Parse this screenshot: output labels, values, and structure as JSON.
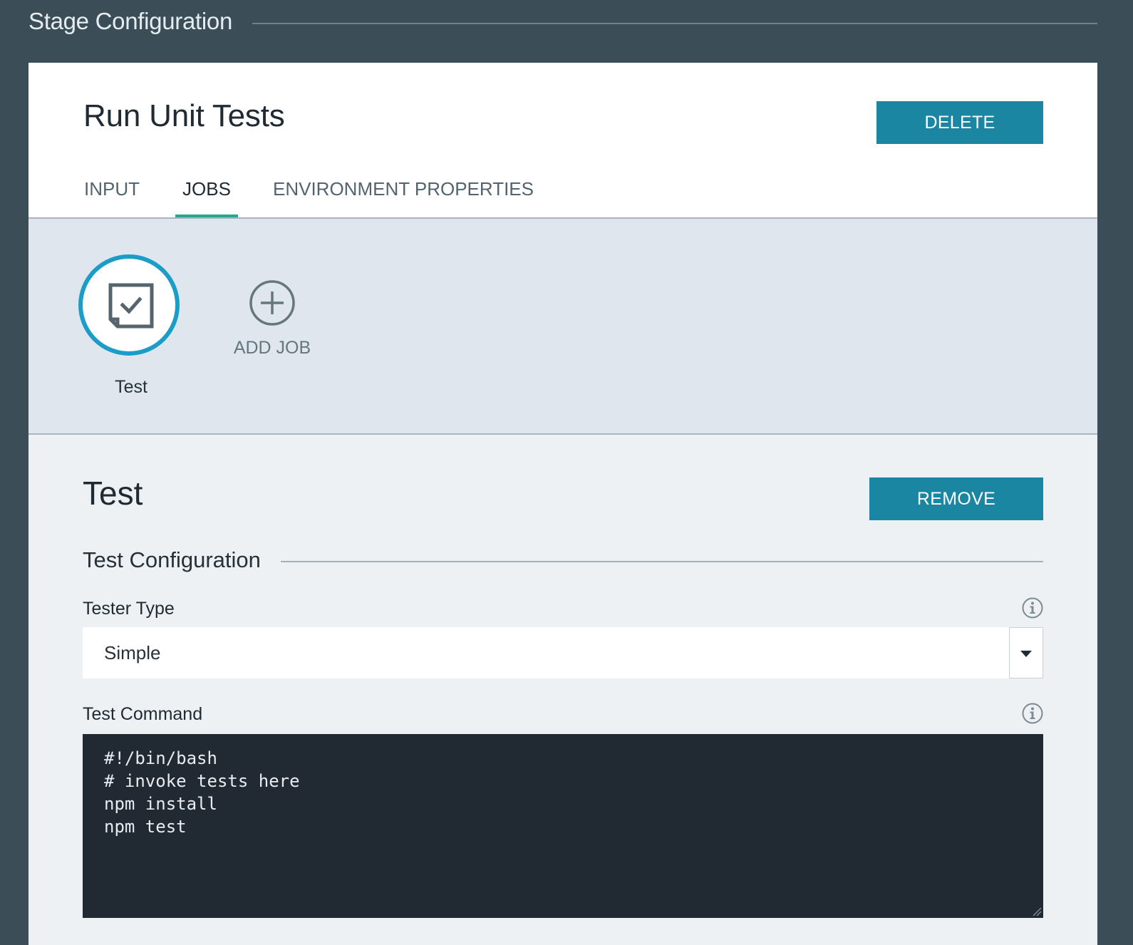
{
  "page": {
    "title": "Stage Configuration"
  },
  "stage": {
    "name": "Run Unit Tests",
    "delete_label": "DELETE"
  },
  "tabs": [
    {
      "label": "INPUT",
      "active": false
    },
    {
      "label": "JOBS",
      "active": true
    },
    {
      "label": "ENVIRONMENT PROPERTIES",
      "active": false
    }
  ],
  "jobs": {
    "items": [
      {
        "name": "Test",
        "icon": "test-job-icon",
        "selected": true
      }
    ],
    "add_label": "ADD JOB"
  },
  "job_detail": {
    "title": "Test",
    "remove_label": "REMOVE",
    "section_title": "Test Configuration",
    "tester_type": {
      "label": "Tester Type",
      "value": "Simple"
    },
    "test_command": {
      "label": "Test Command",
      "lines": [
        "#!/bin/bash",
        "# invoke tests here",
        "npm install",
        "npm test"
      ]
    }
  },
  "colors": {
    "background": "#3b4d57",
    "accent_button": "#1a86a1",
    "tab_underline": "#2aa58f",
    "job_ring": "#1b9dc8",
    "code_background": "#212933"
  }
}
